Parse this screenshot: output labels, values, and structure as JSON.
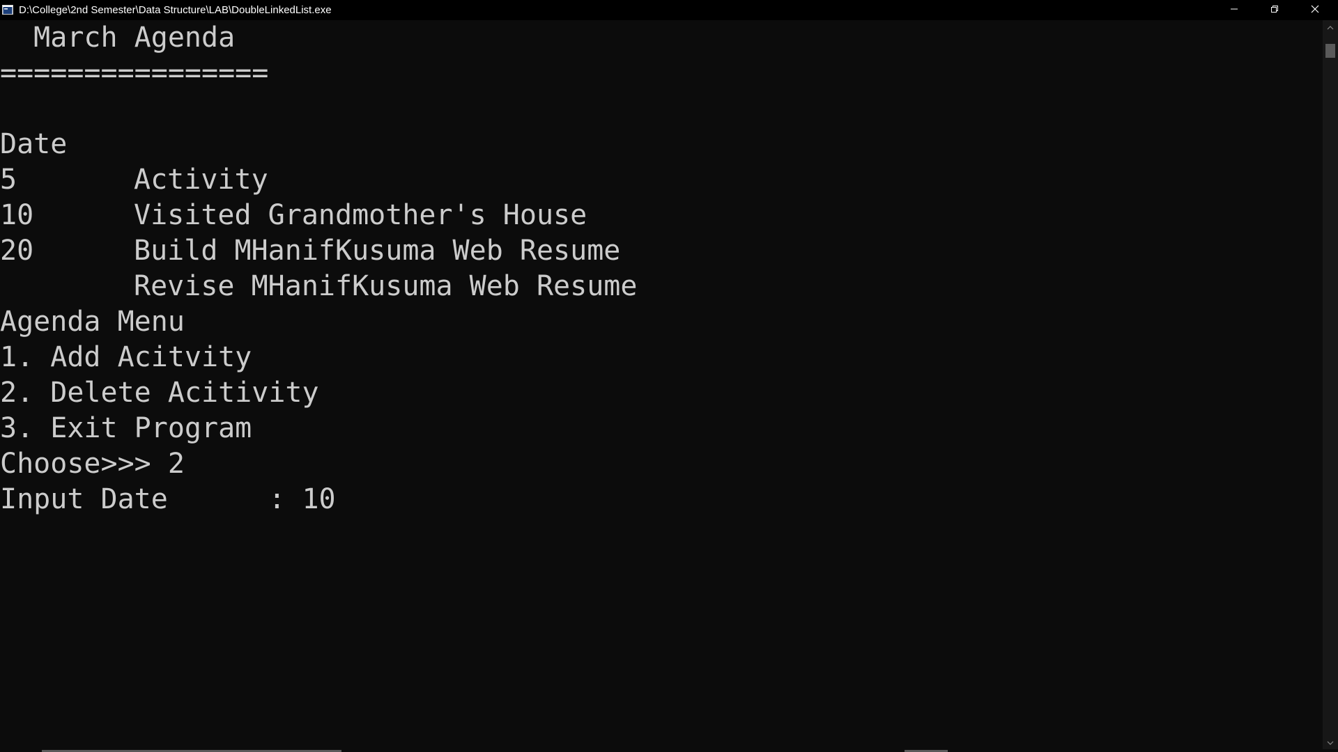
{
  "window": {
    "title": "D:\\College\\2nd Semester\\Data Structure\\LAB\\DoubleLinkedList.exe",
    "icon": "console-app-icon",
    "controls": [
      "minimize-icon",
      "restore-icon",
      "close-icon"
    ]
  },
  "console": {
    "heading": "  March Agenda",
    "separator": "================",
    "table": {
      "headers": [
        "Date",
        "Activity"
      ],
      "rows": [
        [
          "5",
          "Visited Grandmother's House"
        ],
        [
          "10",
          "Build MHanifKusuma Web Resume"
        ],
        [
          "20",
          "Revise MHanifKusuma Web Resume"
        ]
      ]
    },
    "menu": {
      "title": "Agenda Menu",
      "options": [
        "1. Add Acitvity",
        "2. Delete Acitivity",
        "3. Exit Program"
      ]
    },
    "prompt_choose": "Choose>>> 2",
    "prompt_date": "Input Date      : 10"
  },
  "colors": {
    "background": "#0c0c0c",
    "text": "#cccccc",
    "titlebar": "#000000"
  }
}
